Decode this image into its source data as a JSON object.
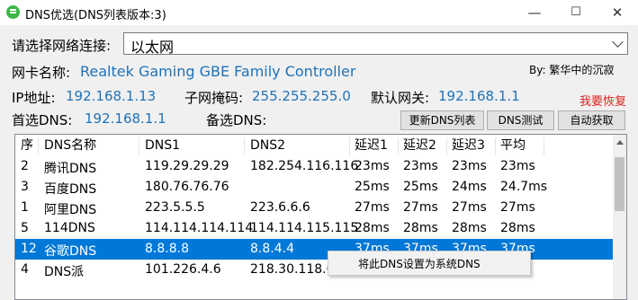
{
  "window": {
    "title": "DNS优选(DNS列表版本:3)",
    "minimize": "—",
    "maximize": "☐",
    "close": "✕"
  },
  "network": {
    "select_label": "请选择网络连接:",
    "selected": "以太网"
  },
  "adapter": {
    "label": "网卡名称:",
    "value": "Realtek Gaming GBE Family Controller"
  },
  "author": "By: 繁华中的沉寂",
  "ip": {
    "label": "IP地址:",
    "value": "192.168.1.13"
  },
  "mask": {
    "label": "子网掩码:",
    "value": "255.255.255.0"
  },
  "gateway": {
    "label": "默认网关:",
    "value": "192.168.1.1"
  },
  "restore_link": "我要恢复",
  "primary_dns": {
    "label": "首选DNS:",
    "value": "192.168.1.1"
  },
  "secondary_dns": {
    "label": "备选DNS:",
    "value": ""
  },
  "buttons": {
    "update": "更新DNS列表",
    "test": "DNS测试",
    "auto": "自动获取"
  },
  "table": {
    "headers": [
      "序",
      "DNS名称",
      "DNS1",
      "DNS2",
      "延迟1",
      "延迟2",
      "延迟3",
      "平均"
    ],
    "rows": [
      [
        "2",
        "腾讯DNS",
        "119.29.29.29",
        "182.254.116.116",
        "23ms",
        "23ms",
        "23ms",
        "23ms"
      ],
      [
        "3",
        "百度DNS",
        "180.76.76.76",
        "",
        "25ms",
        "25ms",
        "24ms",
        "24.7ms"
      ],
      [
        "1",
        "阿里DNS",
        "223.5.5.5",
        "223.6.6.6",
        "27ms",
        "27ms",
        "27ms",
        "27ms"
      ],
      [
        "5",
        "114DNS",
        "114.114.114.114",
        "114.114.115.115",
        "28ms",
        "28ms",
        "28ms",
        "28ms"
      ],
      [
        "12",
        "谷歌DNS",
        "8.8.8.8",
        "8.8.4.4",
        "37ms",
        "37ms",
        "37ms",
        "37ms"
      ],
      [
        "4",
        "DNS派",
        "101.226.4.6",
        "218.30.118.6",
        "",
        "",
        "",
        ""
      ]
    ],
    "selected_row": 4
  },
  "context_menu": {
    "item": "将此DNS设置为系统DNS"
  },
  "colors": {
    "value_blue": "#1e72b8",
    "selection": "#0078d7",
    "restore_red": "#e02020"
  }
}
